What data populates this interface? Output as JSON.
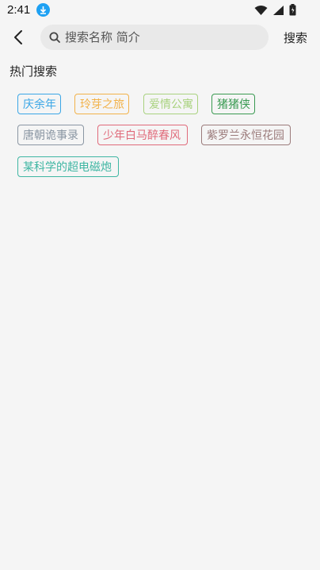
{
  "status_bar": {
    "time": "2:41"
  },
  "header": {
    "search_placeholder": "搜索名称 简介",
    "search_button": "搜索"
  },
  "hot_search": {
    "title": "热门搜索",
    "tags": [
      {
        "label": "庆余年",
        "color": "#3aa6e6"
      },
      {
        "label": "玲芽之旅",
        "color": "#f2b24a"
      },
      {
        "label": "爱情公寓",
        "color": "#a9d27f"
      },
      {
        "label": "猪猪侠",
        "color": "#3a9a52"
      },
      {
        "label": "唐朝诡事录",
        "color": "#8a96a3"
      },
      {
        "label": "少年白马醉春风",
        "color": "#e06a7a"
      },
      {
        "label": "紫罗兰永恒花园",
        "color": "#9b7b7b"
      },
      {
        "label": "某科学的超电磁炮",
        "color": "#3fb6a3"
      }
    ]
  }
}
